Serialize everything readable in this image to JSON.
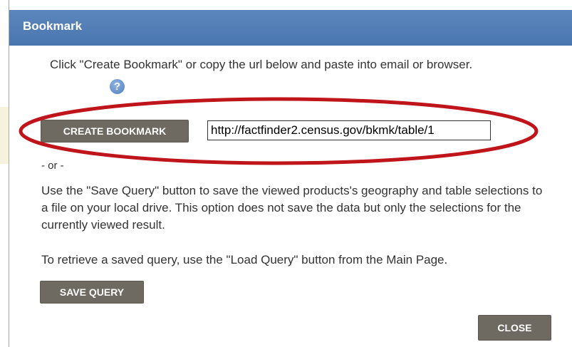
{
  "dialog": {
    "title": "Bookmark",
    "intro_text": "Click \"Create Bookmark\" or copy the url below and paste into email or browser.",
    "help_icon": "?",
    "create_button_label": "CREATE BOOKMARK",
    "url_value": "http://factfinder2.census.gov/bkmk/table/1",
    "or_text": "- or -",
    "save_paragraph": "Use the \"Save Query\" button to save the viewed products's geography and table selections to a file on your local drive. This option does not save the data but only the selections for the currently viewed result.",
    "retrieve_paragraph": "To retrieve a saved query, use the \"Load Query\" button from the Main Page.",
    "save_button_label": "SAVE QUERY",
    "close_button_label": "CLOSE"
  },
  "colors": {
    "titlebar": "#4a76b0",
    "button": "#6e6a62",
    "annotation_ellipse": "#c0141b"
  },
  "icons": {
    "help": "help-question-icon"
  }
}
